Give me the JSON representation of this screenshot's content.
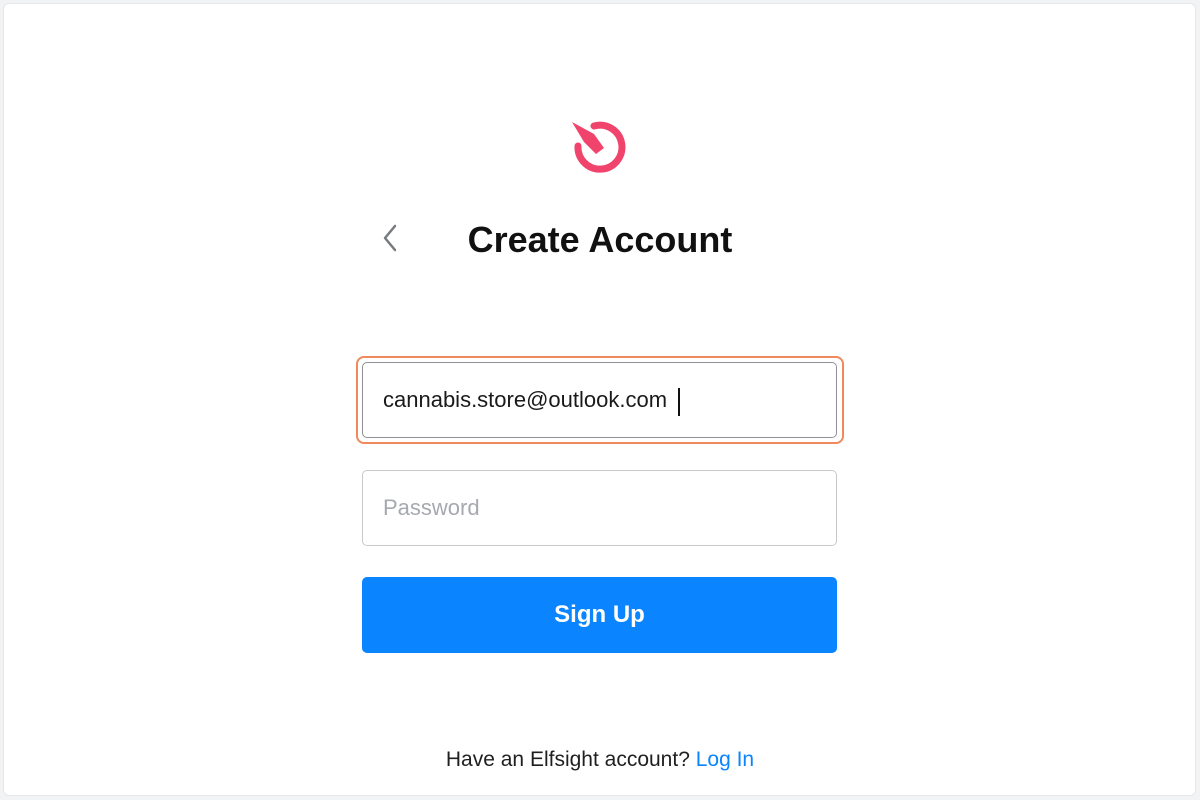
{
  "brand": {
    "logo_icon": "elfsight-gauge-icon",
    "accent_color": "#f0446c"
  },
  "header": {
    "back_icon": "chevron-left-icon",
    "title": "Create Account"
  },
  "form": {
    "email": {
      "value": "cannabis.store@outlook.com",
      "placeholder": "",
      "focus_color": "#f08a5d"
    },
    "password": {
      "value": "",
      "placeholder": "Password"
    },
    "submit_label": "Sign Up",
    "submit_color": "#0a84ff"
  },
  "footer": {
    "prompt": "Have an Elfsight account?",
    "login_link": "Log In"
  }
}
